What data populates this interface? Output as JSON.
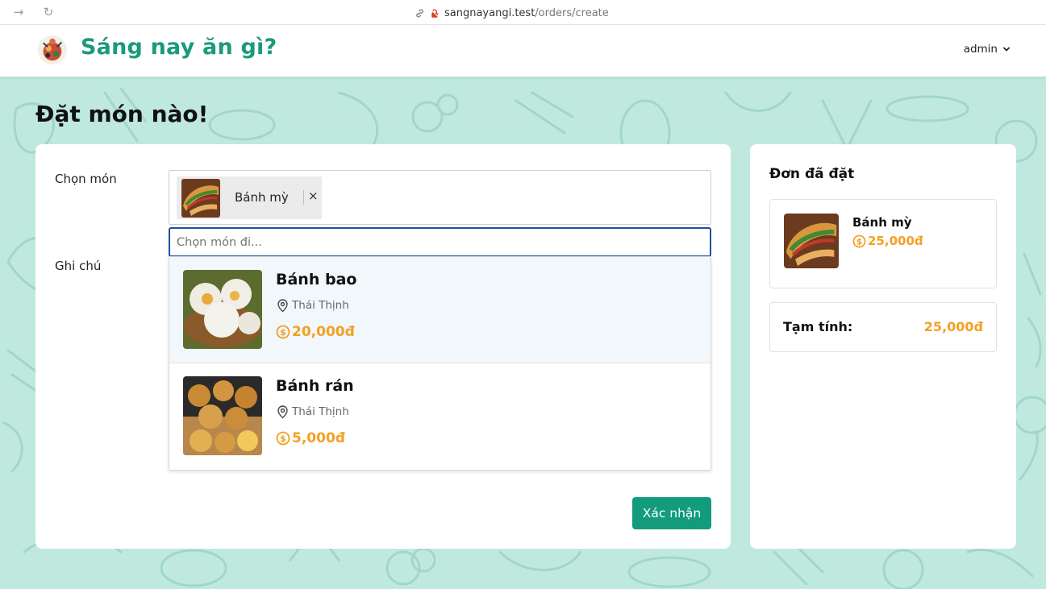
{
  "browser": {
    "url_host": "sangnayangi.test",
    "url_path": "/orders/create"
  },
  "header": {
    "brand": "Sáng nay ăn gì?",
    "user": "admin"
  },
  "page": {
    "title": "Đặt món nào!"
  },
  "form": {
    "choose_label": "Chọn món",
    "note_label": "Ghi chú",
    "selected_items": [
      {
        "name": "Bánh mỳ",
        "remove": "×"
      }
    ],
    "search_placeholder": "Chọn món đi...",
    "options": [
      {
        "name": "Bánh bao",
        "location": "Thái Thịnh",
        "price": "20,000đ"
      },
      {
        "name": "Bánh rán",
        "location": "Thái Thịnh",
        "price": "5,000đ"
      }
    ],
    "confirm_label": "Xác nhận"
  },
  "order_summary": {
    "title": "Đơn đã đặt",
    "items": [
      {
        "name": "Bánh mỳ",
        "price": "25,000đ"
      }
    ],
    "subtotal_label": "Tạm tính:",
    "subtotal_value": "25,000đ"
  },
  "colors": {
    "brand": "#1a9a7c",
    "price": "#f3a023",
    "button": "#129c7c",
    "background": "#bfe9df"
  }
}
